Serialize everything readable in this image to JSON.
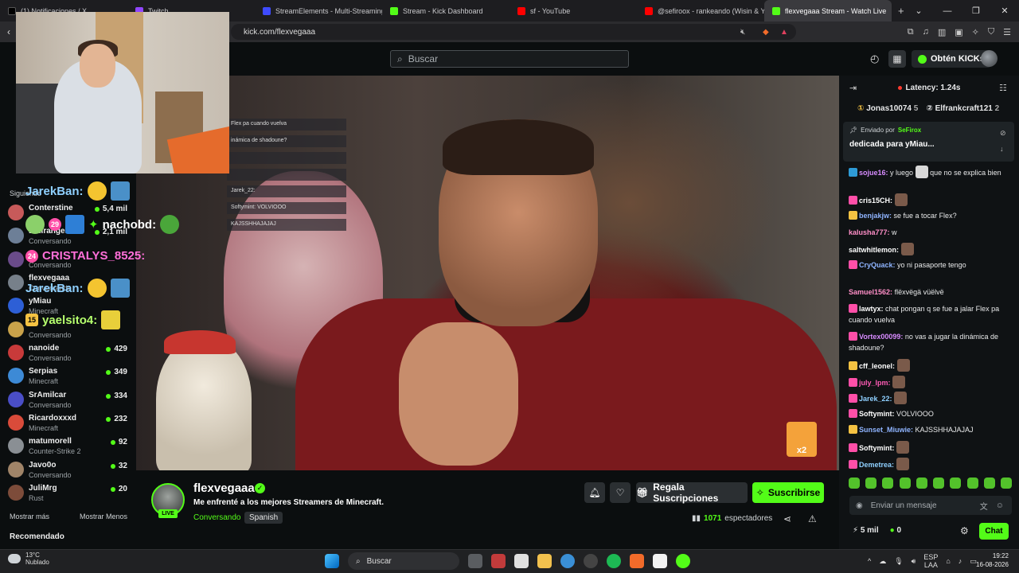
{
  "browser": {
    "tabs": [
      {
        "label": "(1) Notificaciones / X",
        "fav": "#000000"
      },
      {
        "label": "Twitch",
        "fav": "#9146ff"
      },
      {
        "label": "StreamElements - Multi-Streaming",
        "fav": "#3e4bff"
      },
      {
        "label": "Stream - Kick Dashboard",
        "fav": "#53fc18"
      },
      {
        "label": "sf - YouTube",
        "fav": "#ff0000"
      },
      {
        "label": "@sefiroox - rankeando (Wisin & Yan",
        "fav": "#ff0000"
      },
      {
        "label": "flexvegaaa Stream - Watch Live",
        "fav": "#53fc18",
        "active": true
      }
    ],
    "url": "kick.com/flexvegaaa"
  },
  "header": {
    "search_placeholder": "Buscar",
    "get_kicks": "Obtén KICKs"
  },
  "sidebar": {
    "following_title": "Siguiendo",
    "channels": [
      {
        "name": "Conterstine",
        "category": "",
        "viewers": "5,4 mil",
        "color": "#c75a5a"
      },
      {
        "name": "Elhiranger",
        "category": "Conversando",
        "viewers": "2,1 mil",
        "color": "#6d7f97"
      },
      {
        "name": "",
        "category": "Conversando",
        "viewers": "",
        "color": "#6a4b8a"
      },
      {
        "name": "flexvegaaa",
        "category": "Conversando",
        "viewers": "",
        "color": "#77808a"
      },
      {
        "name": "yMiau",
        "category": "Minecraft",
        "viewers": "",
        "color": "#2d5fd6"
      },
      {
        "name": "",
        "category": "Conversando",
        "viewers": "",
        "color": "#c9a24a"
      },
      {
        "name": "nanoide",
        "category": "Conversando",
        "viewers": "429",
        "color": "#c83a3a"
      },
      {
        "name": "Serpias",
        "category": "Minecraft",
        "viewers": "349",
        "color": "#3d8ad6"
      },
      {
        "name": "SrAmilcar",
        "category": "Conversando",
        "viewers": "334",
        "color": "#4a4ec7"
      },
      {
        "name": "Ricardoxxxd",
        "category": "Minecraft",
        "viewers": "232",
        "color": "#d94b3a"
      },
      {
        "name": "matumorell",
        "category": "Counter-Strike 2",
        "viewers": "92",
        "color": "#8a8f94"
      },
      {
        "name": "Javo0o",
        "category": "Conversando",
        "viewers": "32",
        "color": "#a08468"
      },
      {
        "name": "JuliMrg",
        "category": "Rust",
        "viewers": "20",
        "color": "#7d4c3a"
      }
    ],
    "show_more": "Mostrar más",
    "show_less": "Mostrar Menos",
    "recommended": "Recomendado"
  },
  "overlay": {
    "emote_chat": [
      {
        "user": "JarekBan:",
        "color": "#8fd0ff"
      },
      {
        "user": "nachobd:",
        "color": "#ffffff",
        "badge": "29"
      },
      {
        "user": "CRISTALYS_8525:",
        "color": "#ff6fd8",
        "badge": "24"
      },
      {
        "user": "JarekBan:",
        "color": "#8fd0ff"
      },
      {
        "user": "yaelsito4:",
        "color": "#b6ff6e",
        "badge": "15"
      }
    ],
    "stream_chat_lines": [
      "Flex pa cuando vuelva",
      "inámica de shadoune?",
      "",
      "",
      "Jarek_22:",
      "Softymint: VOLVIOOO",
      "KAJSSHHAJAJAJ"
    ],
    "corner_badge": "x2"
  },
  "stream": {
    "channel": "flexvegaaa",
    "live": "LIVE",
    "title": "Me enfrenté a los mejores Streamers de Minecraft.",
    "category": "Conversando",
    "language": "Spanish",
    "gift_button": "Regala Suscripciones",
    "subscribe_button": "Suscribirse",
    "viewer_count": "1071",
    "viewer_label": "espectadores"
  },
  "chat": {
    "latency": "Latency: 1.24s",
    "leaders": [
      {
        "name": "Jonas10074",
        "count": "5"
      },
      {
        "name": "Elfrankcraft121",
        "count": "2"
      }
    ],
    "pinned_label": "Enviado por",
    "pinned_user": "SeFirox",
    "pinned_text": "dedicada para yMiau...",
    "messages": [
      {
        "user": "sojue16:",
        "color": "#d78bff",
        "text": "y luego",
        "text2": "que no se explica bien",
        "badge": "#2e9bd6"
      },
      {
        "user": "cris15CH:",
        "color": "#ffffff",
        "text": "",
        "badge": "#ff4fa8"
      },
      {
        "user": "benjakjw:",
        "color": "#8fb4ff",
        "text": "se fue a tocar Flex?",
        "badge": "#f5c242"
      },
      {
        "user": "kalusha777:",
        "color": "#ff8fc8",
        "text": "w",
        "badge": ""
      },
      {
        "user": "saltwhitlemon:",
        "color": "#ffffff",
        "text": "",
        "badge": ""
      },
      {
        "user": "CryQuack:",
        "color": "#8fb4ff",
        "text": "yo ni pasaporte tengo",
        "badge": "#ff4fa8"
      },
      {
        "user": "Samuel1562:",
        "color": "#ff8fc8",
        "text": "flëxvëgä vüëlvë",
        "badge": ""
      },
      {
        "user": "lawtyx:",
        "color": "#ffffff",
        "text": "chat pongan q se fue a jalar Flex pa cuando vuelva",
        "badge": "#ff4fa8"
      },
      {
        "user": "Vortex00099:",
        "color": "#d78bff",
        "text": "no vas a jugar la dinámica de shadoune?",
        "badge": "#ff4fa8"
      },
      {
        "user": "cff_leonel:",
        "color": "#ffffff",
        "text": "",
        "badge": "#f5c242"
      },
      {
        "user": "july_lpm:",
        "color": "#ff5bb5",
        "text": "",
        "badge": "#ff4fa8"
      },
      {
        "user": "Jarek_22:",
        "color": "#8fd0ff",
        "text": "",
        "badge": "#ff4fa8"
      },
      {
        "user": "Softymint:",
        "color": "#ffffff",
        "text": "VOLVIOOO",
        "badge": "#ff4fa8"
      },
      {
        "user": "Sunset_Miuwie:",
        "color": "#8fb4ff",
        "text": "KAJSSHHAJAJAJ",
        "badge": "#f5c242"
      },
      {
        "user": "Softymint:",
        "color": "#ffffff",
        "text": "",
        "badge": "#ff4fa8"
      },
      {
        "user": "Demetrea:",
        "color": "#8fd0ff",
        "text": "",
        "badge": "#ff4fa8"
      }
    ],
    "input_placeholder": "Enviar un mensaje",
    "points": "5 mil",
    "kicks": "0",
    "send": "Chat"
  },
  "taskbar": {
    "weather_temp": "13°C",
    "weather_desc": "Nublado",
    "search": "Buscar",
    "lang1": "ESP",
    "lang2": "LAA",
    "time": "19:22",
    "date": "16-08-2026"
  },
  "colors": {
    "accent": "#53fc18",
    "bg": "#0b0e0f"
  }
}
